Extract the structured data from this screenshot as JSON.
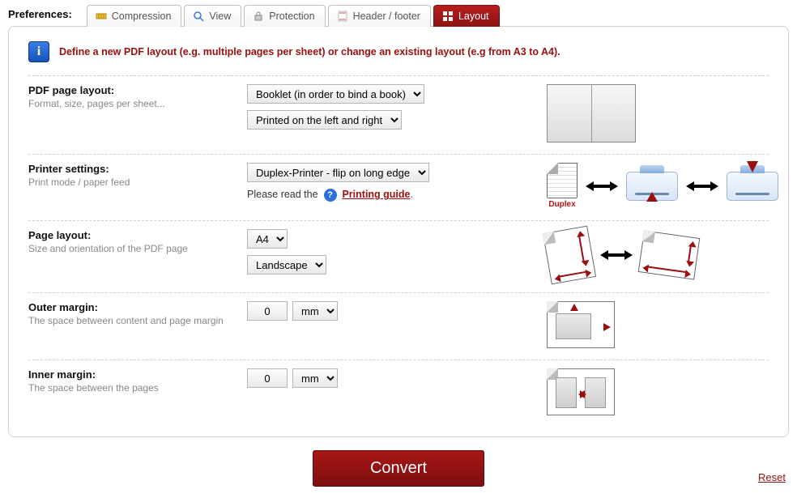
{
  "prefs_label": "Preferences:",
  "tabs": {
    "compression": "Compression",
    "view": "View",
    "protection": "Protection",
    "header_footer": "Header / footer",
    "layout": "Layout"
  },
  "info_text": "Define a new PDF layout (e.g. multiple pages per sheet) or change an existing layout (e.g from A3 to A4).",
  "pdf_page_layout": {
    "title": "PDF page layout:",
    "subtitle": "Format, size, pages per sheet...",
    "mode_value": "Booklet (in order to bind a book)",
    "side_value": "Printed on the left and right"
  },
  "printer_settings": {
    "title": "Printer settings:",
    "subtitle": "Print mode / paper feed",
    "duplex_value": "Duplex-Printer - flip on long edge",
    "hint_prefix": "Please read the",
    "hint_link": "Printing guide",
    "duplex_label": "Duplex"
  },
  "page_layout": {
    "title": "Page layout:",
    "subtitle": "Size and orientation of the PDF page",
    "size_value": "A4",
    "orient_value": "Landscape"
  },
  "outer_margin": {
    "title": "Outer margin:",
    "subtitle": "The space between content and page margin",
    "value": "0",
    "unit": "mm"
  },
  "inner_margin": {
    "title": "Inner margin:",
    "subtitle": "The space between the pages",
    "value": "0",
    "unit": "mm"
  },
  "footer": {
    "convert": "Convert",
    "reset": "Reset"
  }
}
